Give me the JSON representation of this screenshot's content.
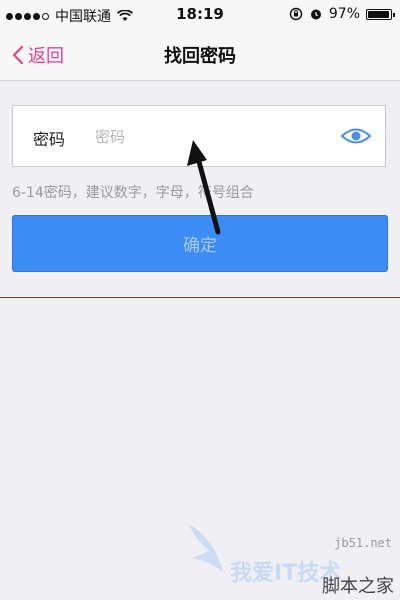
{
  "status_bar": {
    "carrier": "中国联通",
    "time": "18:19",
    "battery": "97%",
    "battery_level": 0.97
  },
  "nav": {
    "back_label": "返回",
    "title": "找回密码"
  },
  "password_field": {
    "label": "密码",
    "placeholder": "密码",
    "value": ""
  },
  "hint": "6-14密码，建议数字，字母，符号组合",
  "confirm_label": "确定",
  "colors": {
    "accent": "#e6408c",
    "button": "#3b8cf5",
    "eye_icon": "#4a90e2",
    "divider": "#c41e1e"
  },
  "icons": [
    "back-chevron-icon",
    "eye-icon",
    "wifi-icon",
    "alarm-icon",
    "lock-rotation-icon"
  ],
  "watermark": {
    "site": "jb51.net",
    "text": "我爱IT技术",
    "brand": "脚本之家"
  }
}
